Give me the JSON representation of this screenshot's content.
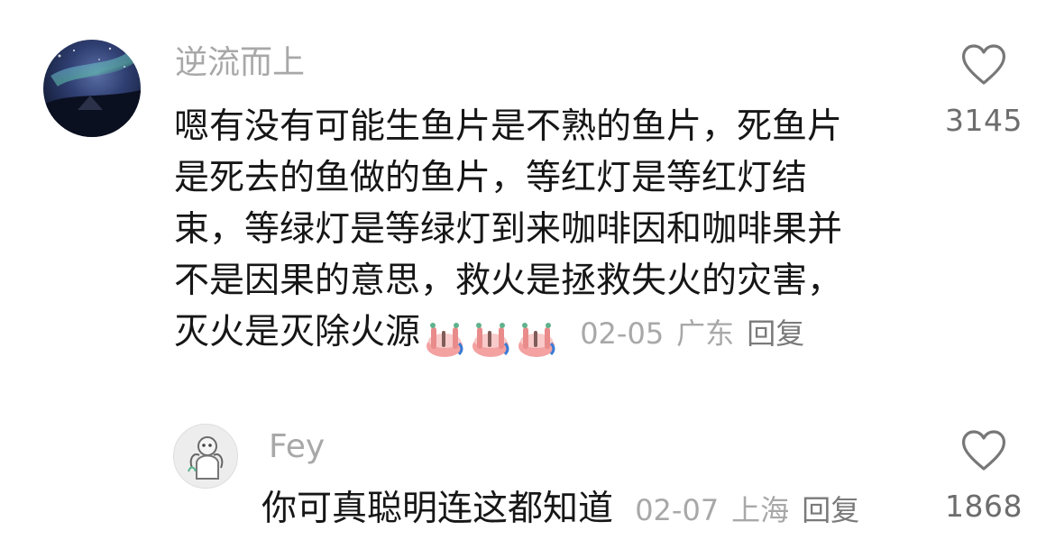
{
  "comment": {
    "username": "逆流而上",
    "text_lines": [
      "嗯有没有可能生鱼片是不熟的鱼片，死鱼片",
      "是死去的鱼做的鱼片，等红灯是等红灯结",
      "束，等绿灯是等绿灯到来咖啡因和咖啡果并",
      "不是因果的意思，救火是拯救失火的灾害，",
      "灭火是灭除火源"
    ],
    "emoji": [
      "shrugging-bowl-emoji",
      "shrugging-bowl-emoji",
      "shrugging-bowl-emoji"
    ],
    "date": "02-05",
    "location": "广东",
    "reply_label": "回复",
    "like_count": "3145"
  },
  "reply": {
    "username": "Fey",
    "text": "你可真聪明连这都知道",
    "date": "02-07",
    "location": "上海",
    "reply_label": "回复",
    "like_count": "1868"
  },
  "icons": {
    "like": "heart-outline-icon"
  }
}
